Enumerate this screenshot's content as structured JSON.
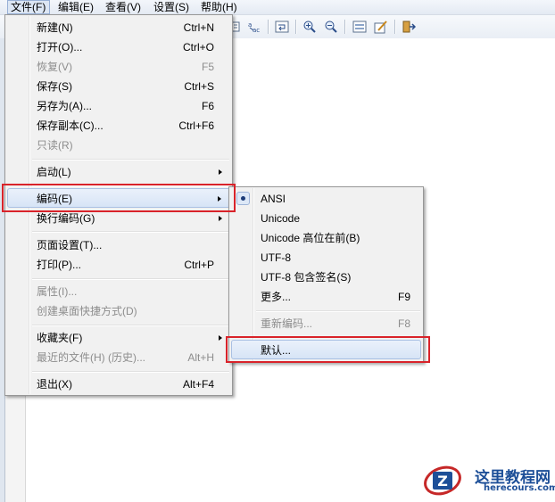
{
  "menubar": {
    "items": [
      "文件(F)",
      "编辑(E)",
      "查看(V)",
      "设置(S)",
      "帮助(H)"
    ]
  },
  "file_menu": {
    "items": [
      {
        "label": "新建(N)",
        "shortcut": "Ctrl+N",
        "enabled": true
      },
      {
        "label": "打开(O)...",
        "shortcut": "Ctrl+O",
        "enabled": true
      },
      {
        "label": "恢复(V)",
        "shortcut": "F5",
        "enabled": false
      },
      {
        "label": "保存(S)",
        "shortcut": "Ctrl+S",
        "enabled": true
      },
      {
        "label": "另存为(A)...",
        "shortcut": "F6",
        "enabled": true
      },
      {
        "label": "保存副本(C)...",
        "shortcut": "Ctrl+F6",
        "enabled": true
      },
      {
        "label": "只读(R)",
        "shortcut": "",
        "enabled": false
      },
      {
        "label": "启动(L)",
        "shortcut": "",
        "enabled": true,
        "submenu": true
      },
      {
        "label": "编码(E)",
        "shortcut": "",
        "enabled": true,
        "submenu": true,
        "highlighted": true
      },
      {
        "label": "换行编码(G)",
        "shortcut": "",
        "enabled": true,
        "submenu": true
      },
      {
        "label": "页面设置(T)...",
        "shortcut": "",
        "enabled": true
      },
      {
        "label": "打印(P)...",
        "shortcut": "Ctrl+P",
        "enabled": true
      },
      {
        "label": "属性(I)...",
        "shortcut": "",
        "enabled": false
      },
      {
        "label": "创建桌面快捷方式(D)",
        "shortcut": "",
        "enabled": false
      },
      {
        "label": "收藏夹(F)",
        "shortcut": "",
        "enabled": true,
        "submenu": true
      },
      {
        "label": "最近的文件(H) (历史)...",
        "shortcut": "Alt+H",
        "enabled": false
      },
      {
        "label": "退出(X)",
        "shortcut": "Alt+F4",
        "enabled": true
      }
    ]
  },
  "encoding_menu": {
    "items": [
      {
        "label": "ANSI",
        "shortcut": "",
        "enabled": true,
        "checked": true
      },
      {
        "label": "Unicode",
        "shortcut": "",
        "enabled": true
      },
      {
        "label": "Unicode 高位在前(B)",
        "shortcut": "",
        "enabled": true
      },
      {
        "label": "UTF-8",
        "shortcut": "",
        "enabled": true
      },
      {
        "label": "UTF-8 包含签名(S)",
        "shortcut": "",
        "enabled": true
      },
      {
        "label": "更多...",
        "shortcut": "F9",
        "enabled": true
      },
      {
        "label": "重新编码...",
        "shortcut": "F8",
        "enabled": false
      },
      {
        "label": "默认...",
        "shortcut": "",
        "enabled": true,
        "highlighted": true
      }
    ]
  },
  "watermark": {
    "title": "这里教程网",
    "url": "herecours.com"
  },
  "colors": {
    "highlight_box": "#d9232a",
    "menu_bg": "#f1f1f1",
    "watermark": "#1d4f98"
  }
}
